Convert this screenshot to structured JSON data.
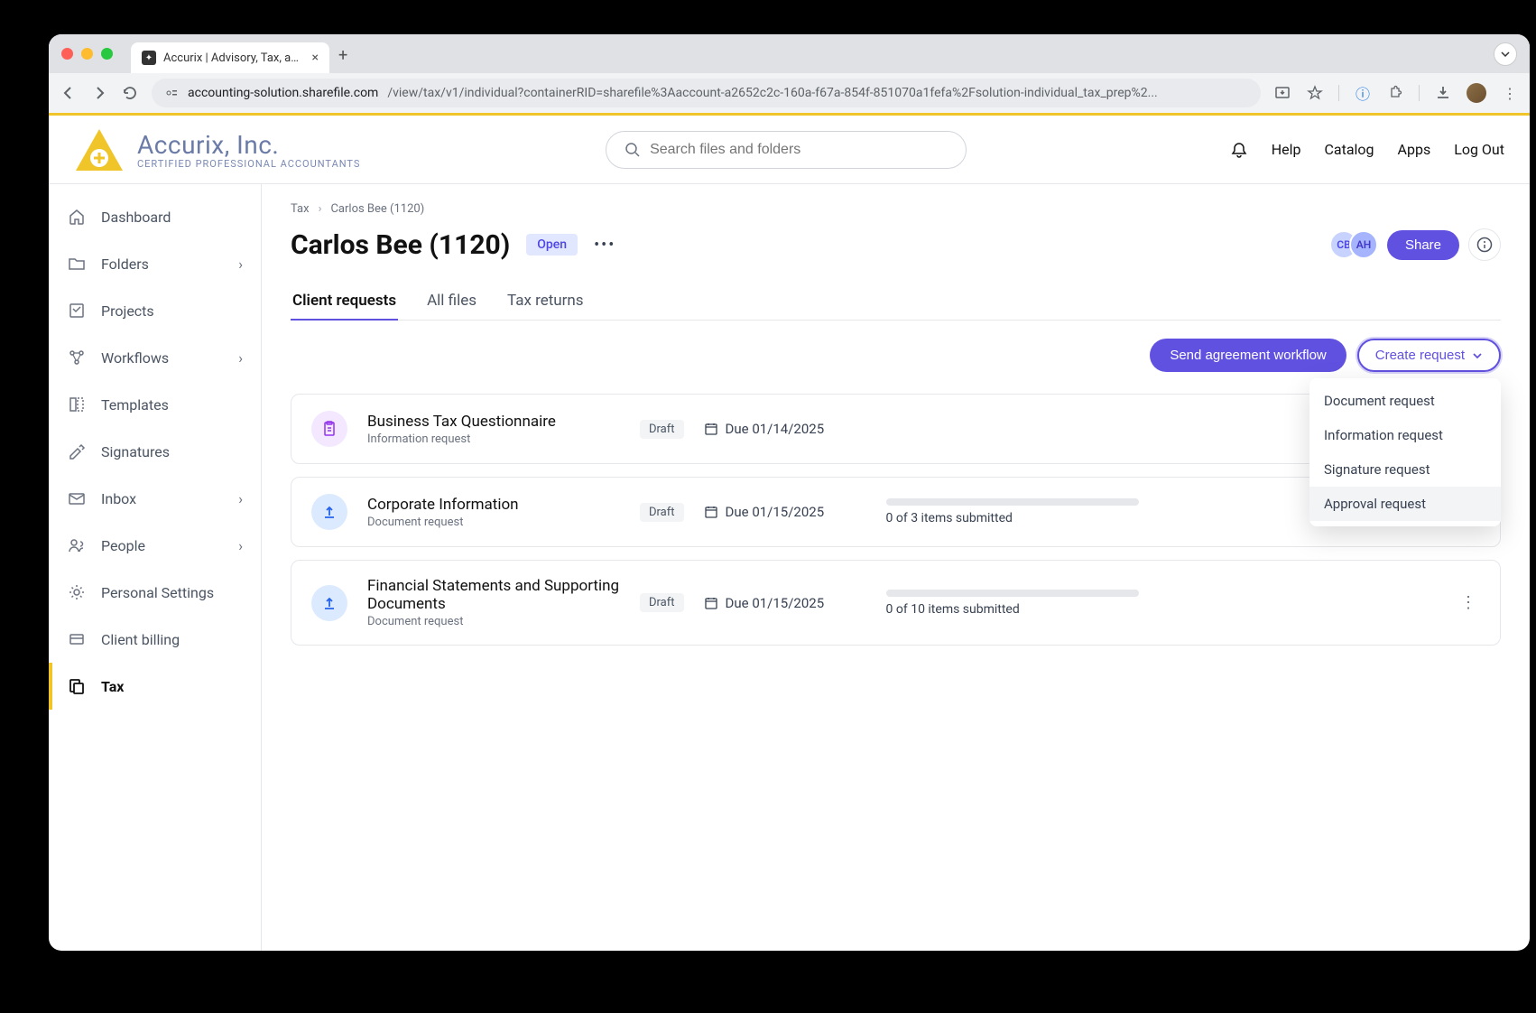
{
  "browser": {
    "tab_title": "Accurix | Advisory, Tax, and A",
    "url_host": "accounting-solution.sharefile.com",
    "url_path": "/view/tax/v1/individual?containerRID=sharefile%3Aaccount-a2652c2c-160a-f67a-854f-851070a1fefa%2Fsolution-individual_tax_prep%2..."
  },
  "brand": {
    "name": "Accurix, Inc.",
    "sub": "CERTIFIED PROFESSIONAL ACCOUNTANTS"
  },
  "search": {
    "placeholder": "Search files and folders"
  },
  "header_links": {
    "help": "Help",
    "catalog": "Catalog",
    "apps": "Apps",
    "logout": "Log Out"
  },
  "sidebar": {
    "items": [
      {
        "label": "Dashboard",
        "expandable": false
      },
      {
        "label": "Folders",
        "expandable": true
      },
      {
        "label": "Projects",
        "expandable": false
      },
      {
        "label": "Workflows",
        "expandable": true
      },
      {
        "label": "Templates",
        "expandable": false
      },
      {
        "label": "Signatures",
        "expandable": false
      },
      {
        "label": "Inbox",
        "expandable": true
      },
      {
        "label": "People",
        "expandable": true
      },
      {
        "label": "Personal Settings",
        "expandable": false
      },
      {
        "label": "Client billing",
        "expandable": false
      },
      {
        "label": "Tax",
        "expandable": false,
        "active": true
      }
    ]
  },
  "breadcrumb": {
    "root": "Tax",
    "current": "Carlos Bee (1120)"
  },
  "page": {
    "title": "Carlos Bee (1120)",
    "status": "Open",
    "share": "Share",
    "avatars": {
      "cb": "CB",
      "ah": "AH"
    }
  },
  "tabs": {
    "client_requests": "Client requests",
    "all_files": "All files",
    "tax_returns": "Tax returns"
  },
  "actions": {
    "send_workflow": "Send agreement workflow",
    "create_request": "Create request"
  },
  "dropdown": {
    "items": [
      "Document request",
      "Information request",
      "Signature request",
      "Approval request"
    ]
  },
  "requests": [
    {
      "title": "Business Tax Questionnaire",
      "sub": "Information request",
      "status": "Draft",
      "due": "Due 01/14/2025",
      "progress": "",
      "icon": "info"
    },
    {
      "title": "Corporate Information",
      "sub": "Document request",
      "status": "Draft",
      "due": "Due 01/15/2025",
      "progress": "0 of 3 items submitted",
      "icon": "doc"
    },
    {
      "title": "Financial Statements and Supporting Documents",
      "sub": "Document request",
      "status": "Draft",
      "due": "Due 01/15/2025",
      "progress": "0 of 10 items submitted",
      "icon": "doc"
    }
  ]
}
